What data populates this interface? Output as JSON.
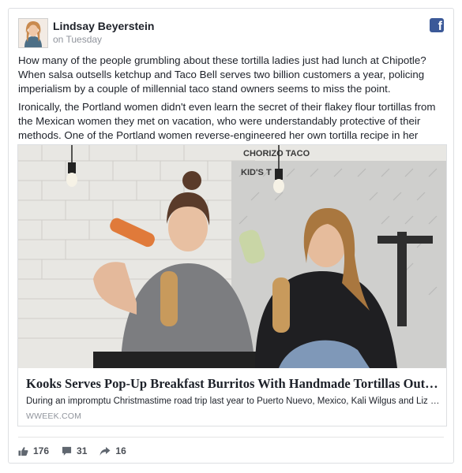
{
  "post": {
    "author": "Lindsay Beyerstein",
    "timestamp": "on Tuesday",
    "paragraphs": [
      "How many of the people grumbling about these tortilla ladies just had lunch at Chipotle? When salsa outsells ketchup and Taco Bell serves two billion customers a year, policing imperialism by a couple of millennial taco stand owners seems to miss the point.",
      "Ironically, the Portland women didn't even learn the secret of their flakey flour tortillas from the Mexican women they met on vacation, who were understandably protective of their methods. One of the Portland women reverse-engineered her own tortilla recipe in her spare time."
    ]
  },
  "link_preview": {
    "photo_sign_text": [
      "CHORIZO TACO",
      "KID'S T"
    ],
    "title": "Kooks Serves Pop-Up Breakfast Burritos With Handmade Tortillas Out o...",
    "description": "During an impromptu Christmastime road trip last year to Puerto Nuevo, Mexico, Kali Wilgus and Liz \"LC\" Co...",
    "domain": "WWEEK.COM"
  },
  "footer": {
    "likes": "176",
    "comments": "31",
    "shares": "16"
  },
  "icons": {
    "brand": "facebook-icon",
    "like": "thumbs-up-icon",
    "comment": "comment-icon",
    "share": "share-arrow-icon"
  },
  "colors": {
    "facebook_blue": "#3b5998",
    "muted_text": "#90949c",
    "border": "#dddfe2"
  }
}
